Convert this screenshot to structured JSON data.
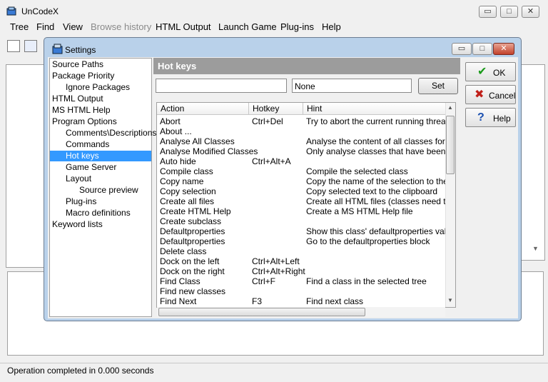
{
  "app": {
    "title": "UnCodeX"
  },
  "window_controls": {
    "minimize": "▭",
    "maximize": "□",
    "close": "✕"
  },
  "menu": [
    "Tree",
    "Find",
    "View",
    "Browse history",
    "HTML Output",
    "Launch Game",
    "Plug-ins",
    "Help"
  ],
  "statusbar": {
    "text": "Operation completed in 0.000 seconds"
  },
  "dialog": {
    "title": "Settings",
    "close_label": "✕",
    "header": "Hot keys",
    "hotkey_value": "None",
    "set_label": "Set",
    "buttons": {
      "ok": "OK",
      "cancel": "Cancel",
      "help": "Help"
    },
    "tree": [
      {
        "label": "Source Paths",
        "level": 0
      },
      {
        "label": "Package Priority",
        "level": 0
      },
      {
        "label": "Ignore Packages",
        "level": 1
      },
      {
        "label": "HTML Output",
        "level": 0
      },
      {
        "label": "MS HTML Help",
        "level": 0
      },
      {
        "label": "Program Options",
        "level": 0
      },
      {
        "label": "Comments\\Descriptions",
        "level": 1
      },
      {
        "label": "Commands",
        "level": 1
      },
      {
        "label": "Hot keys",
        "level": 1,
        "selected": true
      },
      {
        "label": "Game Server",
        "level": 1
      },
      {
        "label": "Layout",
        "level": 1
      },
      {
        "label": "Source preview",
        "level": 2
      },
      {
        "label": "Plug-ins",
        "level": 1
      },
      {
        "label": "Macro definitions",
        "level": 1
      },
      {
        "label": "Keyword lists",
        "level": 0
      }
    ],
    "columns": [
      "Action",
      "Hotkey",
      "Hint"
    ],
    "rows": [
      [
        "Abort",
        "Ctrl+Del",
        "Try to abort the current running thread"
      ],
      [
        "About ...",
        "",
        ""
      ],
      [
        "Analyse All Classes",
        "",
        "Analyse the content of all classes for outp"
      ],
      [
        "Analyse Modified Classes",
        "",
        "Only analyse classes that have been cha"
      ],
      [
        "Auto hide",
        "Ctrl+Alt+A",
        ""
      ],
      [
        "Compile class",
        "",
        "Compile the selected class"
      ],
      [
        "Copy name",
        "",
        "Copy the name of the selection to the clip"
      ],
      [
        "Copy selection",
        "",
        "Copy selected text to the clipboard"
      ],
      [
        "Create all files",
        "",
        "Create all HTML files (classes need to be"
      ],
      [
        "Create HTML Help",
        "",
        "Create a MS HTML Help file"
      ],
      [
        "Create subclass",
        "",
        ""
      ],
      [
        "Defaultproperties",
        "",
        "Show this class' defaultproperties values"
      ],
      [
        "Defaultproperties",
        "",
        "Go to the defaultproperties block"
      ],
      [
        "Delete class",
        "",
        ""
      ],
      [
        "Dock on the left",
        "Ctrl+Alt+Left",
        ""
      ],
      [
        "Dock on the right",
        "Ctrl+Alt+Right",
        ""
      ],
      [
        "Find Class",
        "Ctrl+F",
        "Find a class in the selected tree"
      ],
      [
        "Find new classes",
        "",
        ""
      ],
      [
        "Find Next",
        "F3",
        "Find next class"
      ]
    ]
  }
}
